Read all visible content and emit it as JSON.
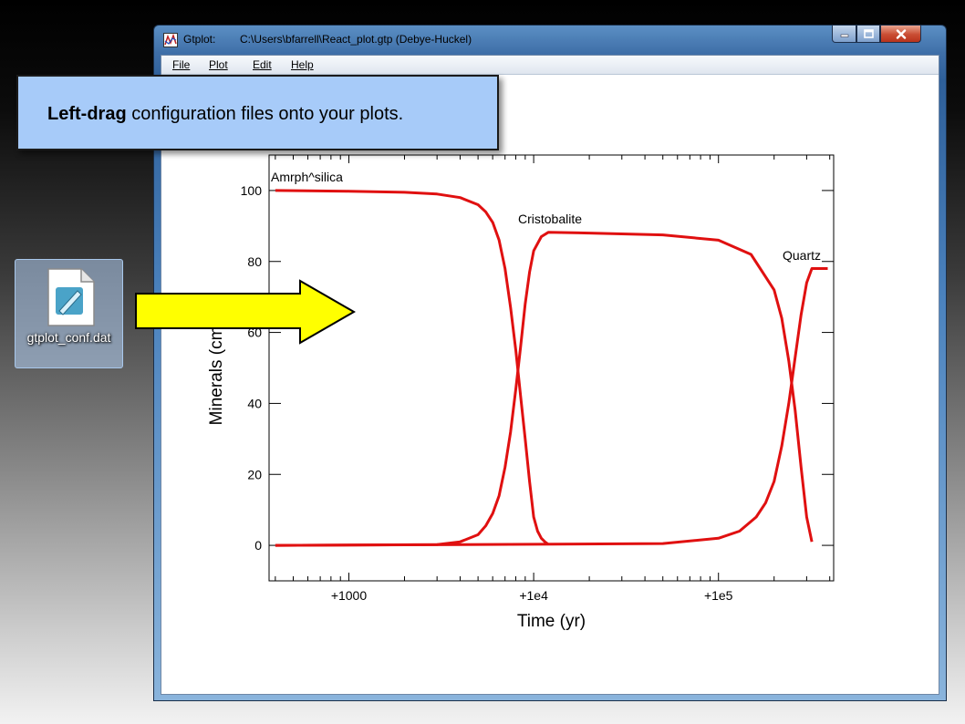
{
  "window": {
    "app_name": "Gtplot:",
    "file_path": "C:\\Users\\bfarrell\\React_plot.gtp  (Debye-Huckel)"
  },
  "menu": [
    {
      "label": "File"
    },
    {
      "label": "Plot"
    },
    {
      "label": "Edit"
    },
    {
      "label": "Help"
    }
  ],
  "callout": {
    "bold": "Left-drag",
    "rest": " configuration files onto your plots."
  },
  "desktop_icon": {
    "label": "gtplot_conf.dat",
    "icon": "document-file-icon"
  },
  "drag_arrow": {
    "icon": "right-arrow-icon",
    "color": "#ffff00"
  },
  "colors": {
    "series": "#e01010",
    "callout_bg": "#a7cbf9"
  },
  "chart_data": {
    "type": "line",
    "xlabel": "Time (yr)",
    "ylabel": "Minerals (cm3)",
    "xscale": "log",
    "xlim": [
      370,
      420000
    ],
    "ylim": [
      -10,
      110
    ],
    "yticks": [
      0,
      20,
      40,
      60,
      80,
      100
    ],
    "xticks": [
      {
        "value": 1000,
        "label": "+1000"
      },
      {
        "value": 10000,
        "label": "+1e4"
      },
      {
        "value": 100000,
        "label": "+1e5"
      }
    ],
    "grid": false,
    "legend": "none",
    "series": [
      {
        "name": "Amrph^silica",
        "x": [
          400,
          1000,
          2000,
          3000,
          4000,
          5000,
          5500,
          6000,
          6500,
          7000,
          7500,
          8000,
          8500,
          9000,
          9500,
          10000,
          10500,
          11000,
          11500,
          12000
        ],
        "y": [
          100,
          99.8,
          99.5,
          99,
          98,
          96,
          94,
          91,
          86,
          78,
          67,
          55,
          42,
          30,
          18,
          8,
          4,
          2,
          1,
          0.3
        ]
      },
      {
        "name": "Cristobalite",
        "x": [
          400,
          3000,
          4000,
          5000,
          5500,
          6000,
          6500,
          7000,
          7500,
          8000,
          8500,
          9000,
          9500,
          10000,
          11000,
          12000,
          20000,
          50000,
          100000,
          150000,
          200000,
          220000,
          240000,
          260000,
          280000,
          300000,
          320000
        ],
        "y": [
          0,
          0.2,
          1,
          3,
          5.5,
          9,
          14,
          22,
          32,
          44,
          56,
          68,
          77,
          83,
          87,
          88.2,
          88,
          87.5,
          86,
          82,
          72,
          64,
          52,
          38,
          22,
          8,
          1
        ]
      },
      {
        "name": "Quartz",
        "x": [
          400,
          10000,
          50000,
          100000,
          130000,
          160000,
          180000,
          200000,
          220000,
          240000,
          260000,
          280000,
          300000,
          320000,
          350000,
          390000
        ],
        "y": [
          0,
          0.3,
          0.5,
          2,
          4,
          8,
          12,
          18,
          28,
          40,
          53,
          65,
          74,
          78,
          78,
          78
        ]
      }
    ]
  }
}
